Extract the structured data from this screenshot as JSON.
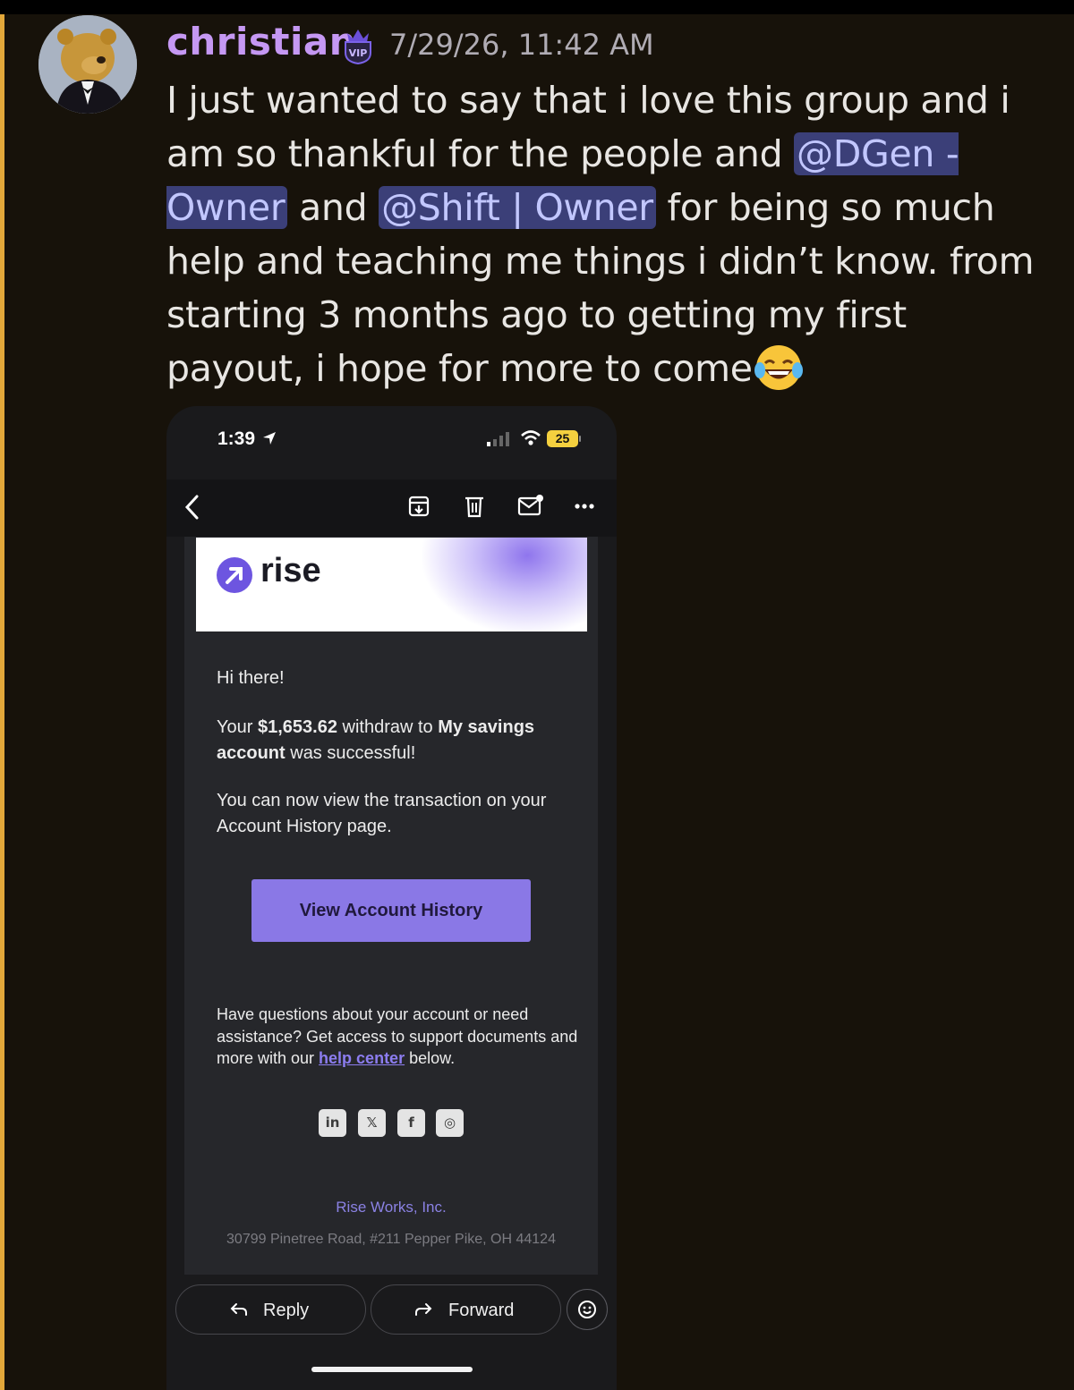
{
  "message": {
    "username": "christian",
    "timestamp": "7/29/26, 11:42 AM",
    "text_1": "I just wanted to say that i love this group and i am so thankful for the people and ",
    "mention_1": "@DGen - Owner",
    "text_2": " and ",
    "mention_2": "@Shift | Owner",
    "text_3": " for being so much help and teaching me things i didn’t know. from starting 3 months ago to getting my first payout, i hope for more to come"
  },
  "phone": {
    "status_time": "1:39",
    "battery": "25"
  },
  "email": {
    "brand": "rise",
    "greeting": "Hi there!",
    "body1_a": "Your ",
    "body1_amount": "$1,653.62",
    "body1_b": " withdraw to ",
    "body1_account": "My savings account",
    "body1_c": " was successful!",
    "body2": "You can now view the transaction on your Account History page.",
    "cta_label": "View Account History",
    "support_a": "Have questions about your account or need assistance? Get access to support documents and more with our ",
    "support_link": "help center",
    "support_b": " below.",
    "social": [
      "in",
      "𝕏",
      "f",
      "◎"
    ],
    "company": "Rise Works, Inc.",
    "address": "30799 Pinetree Road, #211 Pepper Pike, OH 44124"
  },
  "actions": {
    "reply": "Reply",
    "forward": "Forward"
  },
  "colors": {
    "username": "#c598f3",
    "mention_bg": "#3b3f78",
    "cta": "#8a78e6",
    "accent_strip": "#e3a83a"
  }
}
